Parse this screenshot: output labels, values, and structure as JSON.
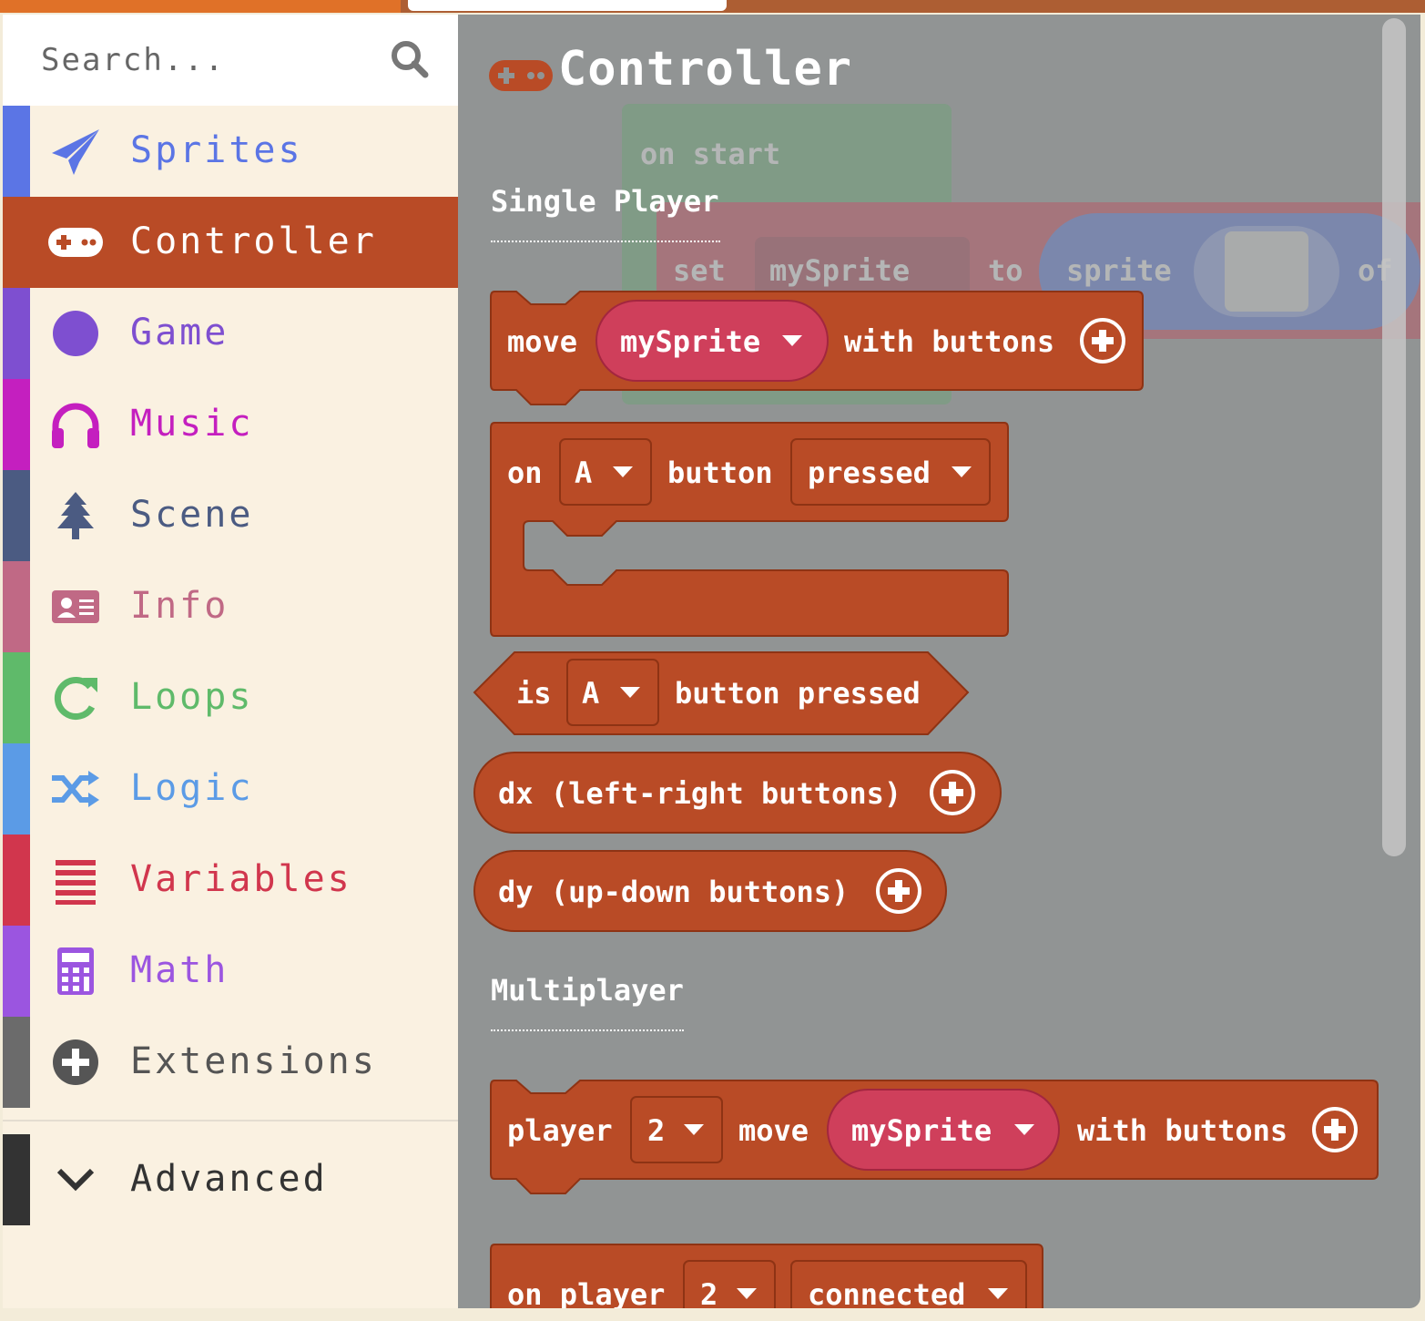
{
  "search": {
    "placeholder": "Search..."
  },
  "categories": [
    {
      "label": "Sprites",
      "color": "#5b75e5",
      "icon": "paper-plane-icon"
    },
    {
      "label": "Controller",
      "color": "#b94b26",
      "icon": "gamepad-icon",
      "selected": true
    },
    {
      "label": "Game",
      "color": "#7e4fd0",
      "icon": "circle-icon"
    },
    {
      "label": "Music",
      "color": "#c41fbf",
      "icon": "headphones-icon"
    },
    {
      "label": "Scene",
      "color": "#4b5b82",
      "icon": "tree-icon"
    },
    {
      "label": "Info",
      "color": "#c06985",
      "icon": "id-card-icon"
    },
    {
      "label": "Loops",
      "color": "#5fba6a",
      "icon": "redo-icon"
    },
    {
      "label": "Logic",
      "color": "#5b9be6",
      "icon": "shuffle-icon"
    },
    {
      "label": "Variables",
      "color": "#d1364d",
      "icon": "list-icon"
    },
    {
      "label": "Math",
      "color": "#9b55e0",
      "icon": "calculator-icon"
    },
    {
      "label": "Extensions",
      "color": "#555555",
      "icon": "plus-circle-icon"
    }
  ],
  "advanced": {
    "label": "Advanced",
    "icon": "chevron-down-icon"
  },
  "flyout": {
    "title": "Controller",
    "sections": {
      "single": "Single Player",
      "multi": "Multiplayer"
    },
    "blocks": {
      "move": {
        "word_move": "move",
        "sprite": "mySprite",
        "tail": "with buttons"
      },
      "onbtn": {
        "word_on": "on",
        "button": "A",
        "word_button": "button",
        "event": "pressed"
      },
      "isbtn": {
        "word_is": "is",
        "button": "A",
        "tail": "button pressed"
      },
      "dx": {
        "text": "dx (left-right buttons)"
      },
      "dy": {
        "text": "dy (up-down buttons)"
      },
      "playermove": {
        "word_player": "player",
        "num": "2",
        "word_move": "move",
        "sprite": "mySprite",
        "tail": "with buttons"
      },
      "onplayer": {
        "text": "on player",
        "num": "2",
        "event": "connected"
      }
    },
    "workspace": {
      "on_start": "on start",
      "set": "set",
      "var": "mySprite",
      "to": "to",
      "sprite": "sprite",
      "of": "of"
    }
  },
  "colors": {
    "controller": "#b94b26",
    "sprite_pill": "#cf3f5b",
    "flyout_bg": "#919494",
    "toolbox_bg": "#faf1e1",
    "topbar": "#e07128"
  }
}
